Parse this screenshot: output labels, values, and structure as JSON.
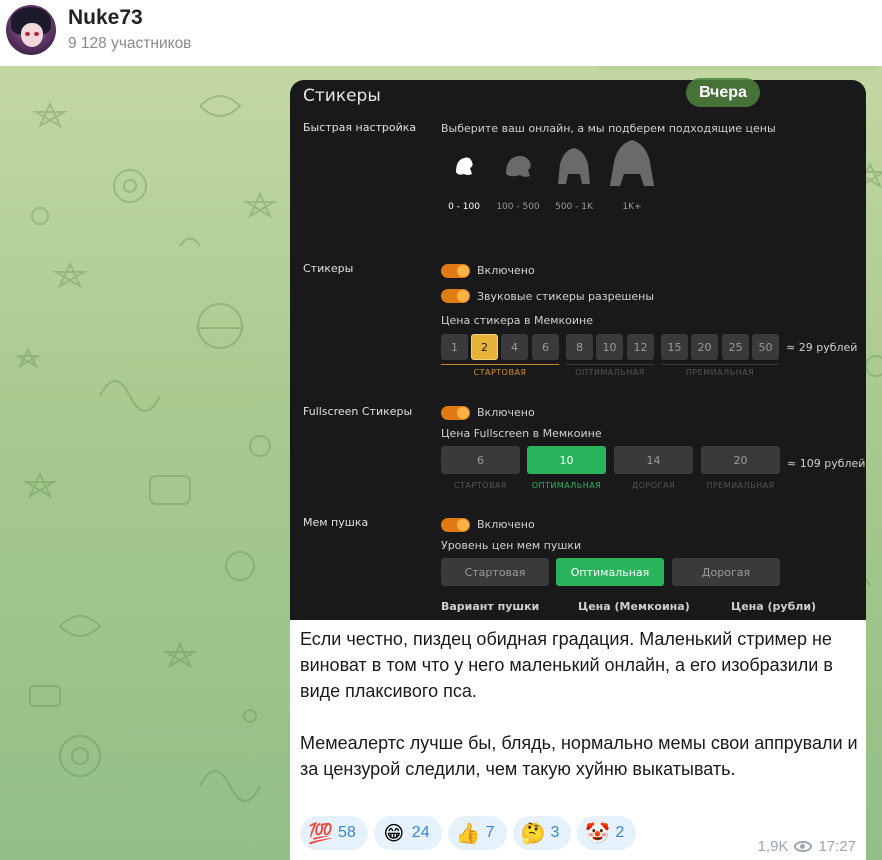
{
  "header": {
    "title": "Nuke73",
    "subtitle": "9 128 участников"
  },
  "date_chip": "Вчера",
  "screenshot": {
    "title": "Стикеры",
    "quick": {
      "label": "Быстрая настройка",
      "hint": "Выберите ваш онлайн, а мы подберем подходящие цены",
      "tiers": [
        "0 - 100",
        "100 - 500",
        "500 - 1K",
        "1K+"
      ]
    },
    "stickers": {
      "label": "Стикеры",
      "toggle1": "Включено",
      "toggle2": "Звуковые стикеры разрешены",
      "price_label": "Цена стикера в Мемкоине",
      "prices": [
        "1",
        "2",
        "4",
        "6",
        "8",
        "10",
        "12",
        "15",
        "20",
        "25",
        "50"
      ],
      "selected": "2",
      "rub": "≈ 29 рублей",
      "groups": [
        "СТАРТОВАЯ",
        "ОПТИМАЛЬНАЯ",
        "ПРЕМИАЛЬНАЯ"
      ]
    },
    "fullscreen": {
      "label": "Fullscreen Стикеры",
      "toggle": "Включено",
      "price_label": "Цена Fullscreen в Мемкоине",
      "prices": [
        "6",
        "10",
        "14",
        "20"
      ],
      "selected": "10",
      "rub": "≈ 109 рублей",
      "groups": [
        "СТАРТОВАЯ",
        "ОПТИМАЛЬНАЯ",
        "ДОРОГАЯ",
        "ПРЕМИАЛЬНАЯ"
      ]
    },
    "meme": {
      "label": "Мем пушка",
      "toggle": "Включено",
      "level_label": "Уровень цен мем пушки",
      "levels": [
        "Стартовая",
        "Оптимальная",
        "Дорогая"
      ],
      "selected": "Оптимальная",
      "columns": [
        "Вариант пушки",
        "Цена (Мемкоина)",
        "Цена (рубли)"
      ]
    }
  },
  "message": {
    "p1": "Если честно, пиздец обидная градация. Маленький стример не виноват в том что у него маленький онлайн, а его изобразили в виде плаксивого пса.",
    "p2": "Мемеалертс лучше бы, блядь, нормально мемы свои аппрували и за цензурой следили, чем такую хуйню выкатывать."
  },
  "reactions": [
    {
      "emoji": "💯",
      "count": "58",
      "icon": "hundred-icon"
    },
    {
      "emoji": "😁",
      "count": "24",
      "icon": "grin-icon"
    },
    {
      "emoji": "👍",
      "count": "7",
      "icon": "thumbs-up-icon"
    },
    {
      "emoji": "🤔",
      "count": "3",
      "icon": "thinking-icon"
    },
    {
      "emoji": "🤡",
      "count": "2",
      "icon": "clown-icon"
    }
  ],
  "meta": {
    "views": "1,9K",
    "time": "17:27"
  }
}
